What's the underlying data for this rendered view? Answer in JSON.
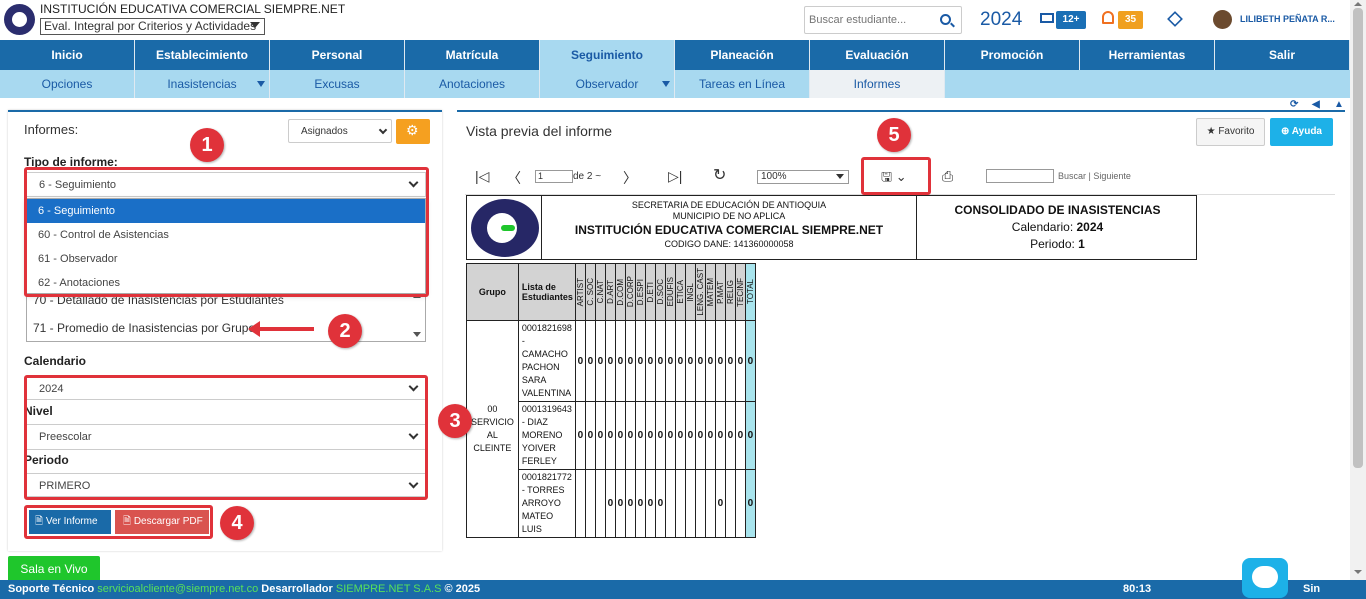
{
  "header": {
    "institution": "INSTITUCIÓN EDUCATIVA COMERCIAL SIEMPRE.NET",
    "mode_select": "Eval. Integral por Criterios y Actividades",
    "search_placeholder": "Buscar estudiante...",
    "year": "2024",
    "mail_badge": "12+",
    "notif_badge": "35",
    "user": "LILIBETH PEÑATA R..."
  },
  "nav": {
    "main": [
      "Inicio",
      "Establecimiento",
      "Personal",
      "Matrícula",
      "Seguimiento",
      "Planeación",
      "Evaluación",
      "Promoción",
      "Herramientas",
      "Salir"
    ],
    "sub": [
      "Opciones",
      "Inasistencias",
      "Excusas",
      "Anotaciones",
      "Observador",
      "Tareas en Línea",
      "Informes"
    ]
  },
  "left": {
    "title": "Informes:",
    "assign": "Asignados",
    "tipo_label": "Tipo de informe:",
    "tipo_value": "6 - Seguimiento",
    "dropdown_options": [
      "6 - Seguimiento",
      "60 - Control de Asistencias",
      "61 - Observador",
      "62 - Anotaciones"
    ],
    "list_options": [
      "70 - Detallado de Inasistencias por Estudiantes",
      "71 - Promedio de Inasistencias por Grupo"
    ],
    "calendario_label": "Calendario",
    "calendario_value": "2024",
    "nivel_label": "Nivel",
    "nivel_value": "Preescolar",
    "periodo_label": "Periodo",
    "periodo_value": "PRIMERO",
    "ver_btn": "Ver Informe",
    "pdf_btn": "Descargar PDF",
    "sala_btn": "Sala en Vivo"
  },
  "annotations": [
    "1",
    "2",
    "3",
    "4",
    "5"
  ],
  "preview": {
    "title": "Vista previa del informe",
    "fav_btn": "Favorito",
    "help_btn": "Ayuda",
    "page_value": "1",
    "page_of": "de 2 ~",
    "zoom": "100%",
    "find_label": "Buscar",
    "find_sep": "|",
    "next_label": "Siguiente"
  },
  "report": {
    "line1": "SECRETARIA DE EDUCACIÓN DE ANTIOQUIA",
    "line2": "MUNICIPIO DE  NO APLICA",
    "line3": "INSTITUCIÓN EDUCATIVA COMERCIAL SIEMPRE.NET",
    "line4": "CODIGO DANE: 141360000058",
    "r_title": "CONSOLIDADO DE INASISTENCIAS",
    "r_cal_label": "Calendario:",
    "r_cal": "2024",
    "r_per_label": "Periodo:",
    "r_per": "1",
    "col_group": "Grupo",
    "col_list": "Lista de Estudiantes",
    "subjects": [
      "ARTIST",
      "C. SOC",
      "C.NAT",
      "D.ART",
      "D.COM",
      "D.CORP",
      "D.ESPI",
      "D.ETI",
      "D.SOC",
      "EDUFIS",
      "ETICA",
      "INGL",
      "LENG. CAST",
      "MATEM",
      "P.MAT",
      "RELIG",
      "TECINF"
    ],
    "col_total": "TOTAL",
    "group": "00 SERVICIO AL CLEINTE",
    "rows": [
      {
        "name": "0001821698 - CAMACHO PACHON SARA VALENTINA",
        "vals": [
          "0",
          "0",
          "0",
          "0",
          "0",
          "0",
          "0",
          "0",
          "0",
          "0",
          "0",
          "0",
          "0",
          "0",
          "0",
          "0",
          "0"
        ],
        "total": "0"
      },
      {
        "name": "0001319643 - DIAZ MORENO YOIVER FERLEY",
        "vals": [
          "0",
          "0",
          "0",
          "0",
          "0",
          "0",
          "0",
          "0",
          "0",
          "0",
          "0",
          "0",
          "0",
          "0",
          "0",
          "0",
          "0"
        ],
        "total": "0"
      },
      {
        "name": "0001821772 - TORRES ARROYO MATEO LUIS",
        "vals": [
          "",
          "",
          "",
          "0",
          "0",
          "0",
          "0",
          "0",
          "0",
          "",
          "",
          "",
          "",
          "",
          "0",
          "",
          ""
        ],
        "total": "0"
      }
    ]
  },
  "footer": {
    "support_label": "Soporte Técnico",
    "email": "servicioalcliente@siempre.net.co",
    "dev_label": "Desarrollador",
    "dev": "SIEMPRE.NET S.A.S",
    "copy": "© 2025",
    "time": "80:13",
    "brand": "Sin"
  }
}
